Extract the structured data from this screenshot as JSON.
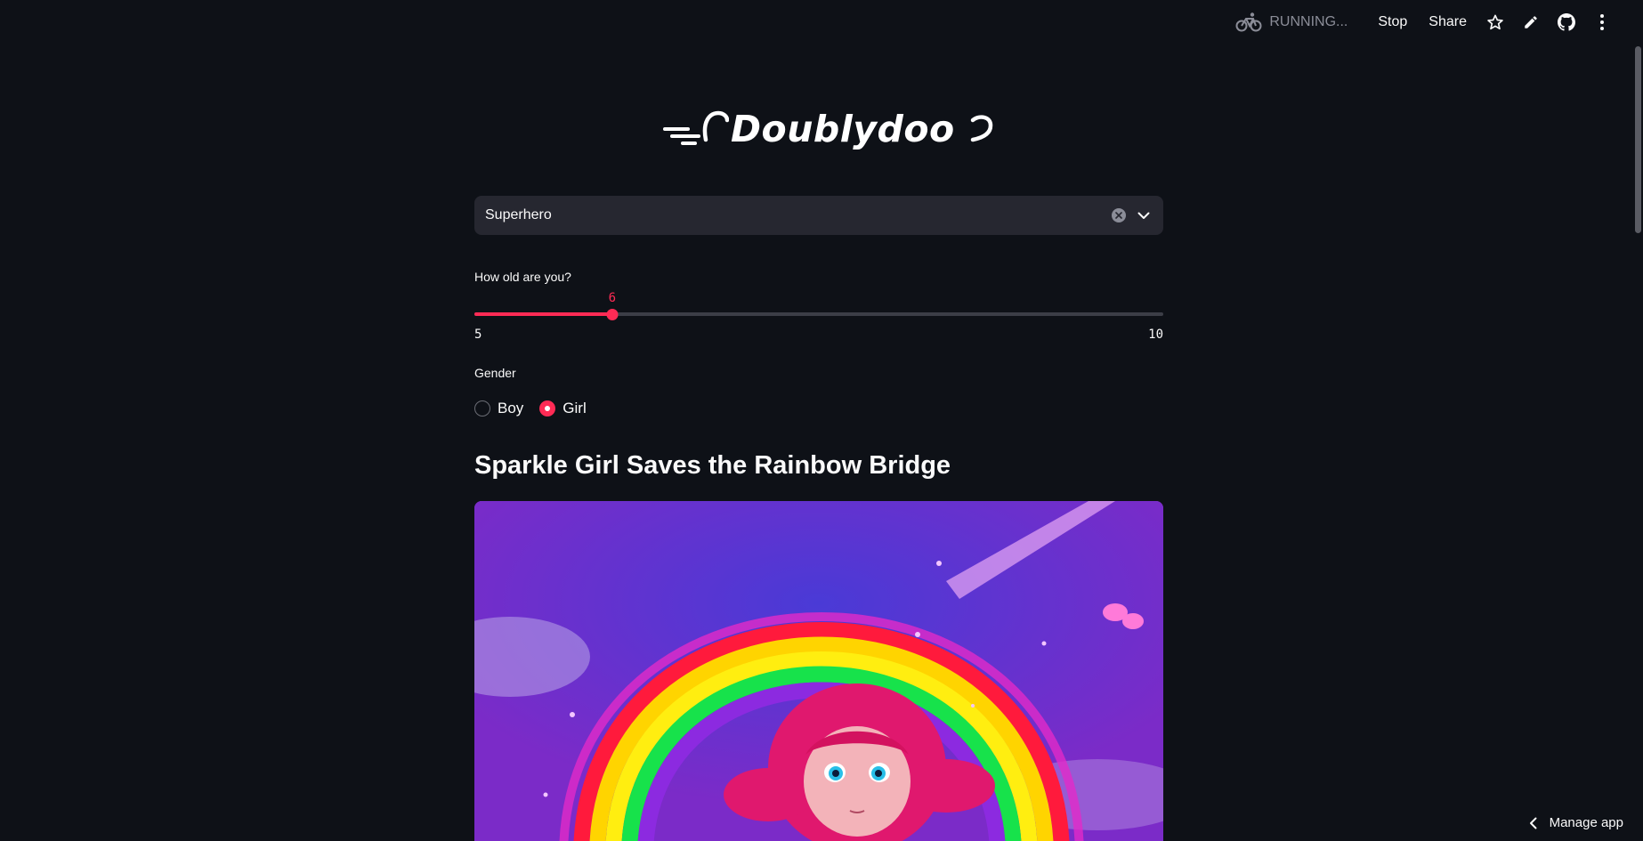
{
  "toolbar": {
    "status": "RUNNING...",
    "stop_label": "Stop",
    "share_label": "Share",
    "icons": [
      "running-bike-icon",
      "star-icon",
      "edit-pencil-icon",
      "github-icon",
      "more-vert-icon"
    ]
  },
  "app": {
    "logo_text": "Doublydoo"
  },
  "theme_select": {
    "value": "Superhero"
  },
  "age_slider": {
    "label": "How old are you?",
    "value": 6,
    "min": 5,
    "max": 10,
    "value_text": "6",
    "min_text": "5",
    "max_text": "10"
  },
  "gender": {
    "label": "Gender",
    "options": [
      {
        "label": "Boy",
        "checked": false
      },
      {
        "label": "Girl",
        "checked": true
      }
    ]
  },
  "story": {
    "title": "Sparkle Girl Saves the Rainbow Bridge"
  },
  "footer": {
    "manage_label": "Manage app"
  },
  "colors": {
    "background": "#0e1117",
    "accent": "#ff2b55",
    "input_bg": "#262730"
  }
}
